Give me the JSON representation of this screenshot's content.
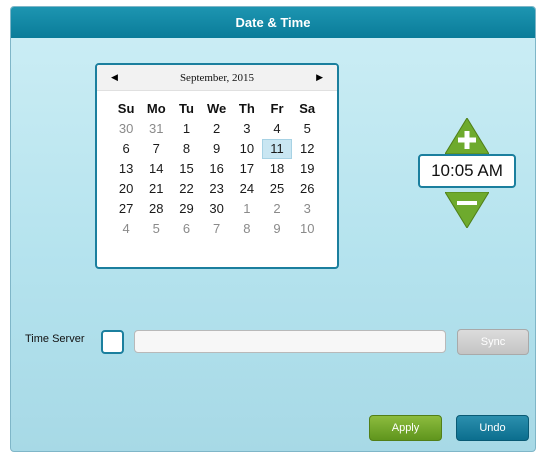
{
  "window": {
    "title": "Date & Time"
  },
  "calendar": {
    "month_label": "September, 2015",
    "weekdays": [
      "Su",
      "Mo",
      "Tu",
      "We",
      "Th",
      "Fr",
      "Sa"
    ],
    "weeks": [
      [
        {
          "d": "30",
          "o": true
        },
        {
          "d": "31",
          "o": true
        },
        {
          "d": "1"
        },
        {
          "d": "2"
        },
        {
          "d": "3"
        },
        {
          "d": "4"
        },
        {
          "d": "5"
        }
      ],
      [
        {
          "d": "6"
        },
        {
          "d": "7"
        },
        {
          "d": "8"
        },
        {
          "d": "9"
        },
        {
          "d": "10"
        },
        {
          "d": "11",
          "sel": true
        },
        {
          "d": "12"
        }
      ],
      [
        {
          "d": "13"
        },
        {
          "d": "14"
        },
        {
          "d": "15"
        },
        {
          "d": "16"
        },
        {
          "d": "17"
        },
        {
          "d": "18"
        },
        {
          "d": "19"
        }
      ],
      [
        {
          "d": "20"
        },
        {
          "d": "21"
        },
        {
          "d": "22"
        },
        {
          "d": "23"
        },
        {
          "d": "24"
        },
        {
          "d": "25"
        },
        {
          "d": "26"
        }
      ],
      [
        {
          "d": "27"
        },
        {
          "d": "28"
        },
        {
          "d": "29"
        },
        {
          "d": "30"
        },
        {
          "d": "1",
          "o": true
        },
        {
          "d": "2",
          "o": true
        },
        {
          "d": "3",
          "o": true
        }
      ],
      [
        {
          "d": "4",
          "o": true
        },
        {
          "d": "5",
          "o": true
        },
        {
          "d": "6",
          "o": true
        },
        {
          "d": "7",
          "o": true
        },
        {
          "d": "8",
          "o": true
        },
        {
          "d": "9",
          "o": true
        },
        {
          "d": "10",
          "o": true
        }
      ]
    ],
    "prev_icon": "triangle-left-icon",
    "next_icon": "triangle-right-icon"
  },
  "time": {
    "value": "10:05 AM",
    "increment_icon": "plus-icon",
    "decrement_icon": "minus-icon"
  },
  "time_server": {
    "label": "Time Server",
    "value": "",
    "placeholder": "",
    "sync_label": "Sync"
  },
  "actions": {
    "apply_label": "Apply",
    "undo_label": "Undo"
  },
  "colors": {
    "title_bar": "#0a7c99",
    "border_accent": "#1b7f9e",
    "spinner_green": "#6eaa2d",
    "apply_green": "#6a9f25",
    "undo_blue": "#0b6e8e",
    "selected_day": "#c9e6f2"
  }
}
